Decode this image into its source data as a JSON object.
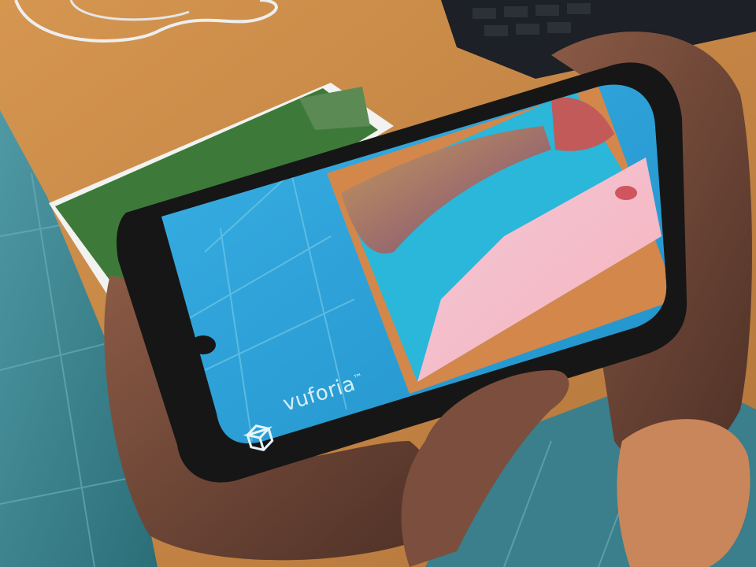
{
  "photo": {
    "subject": "hand-holding-smartphone-ar-app",
    "phone_screen": {
      "ar_brand_text": "vuforia",
      "ar_brand_suffix": "™"
    }
  },
  "colors": {
    "desk_wood": "#c98a45",
    "floor_tile": "#3f8c98",
    "phone_case": "#161616",
    "screen_water": "#2fa6dc",
    "skin": "#6b4536"
  }
}
